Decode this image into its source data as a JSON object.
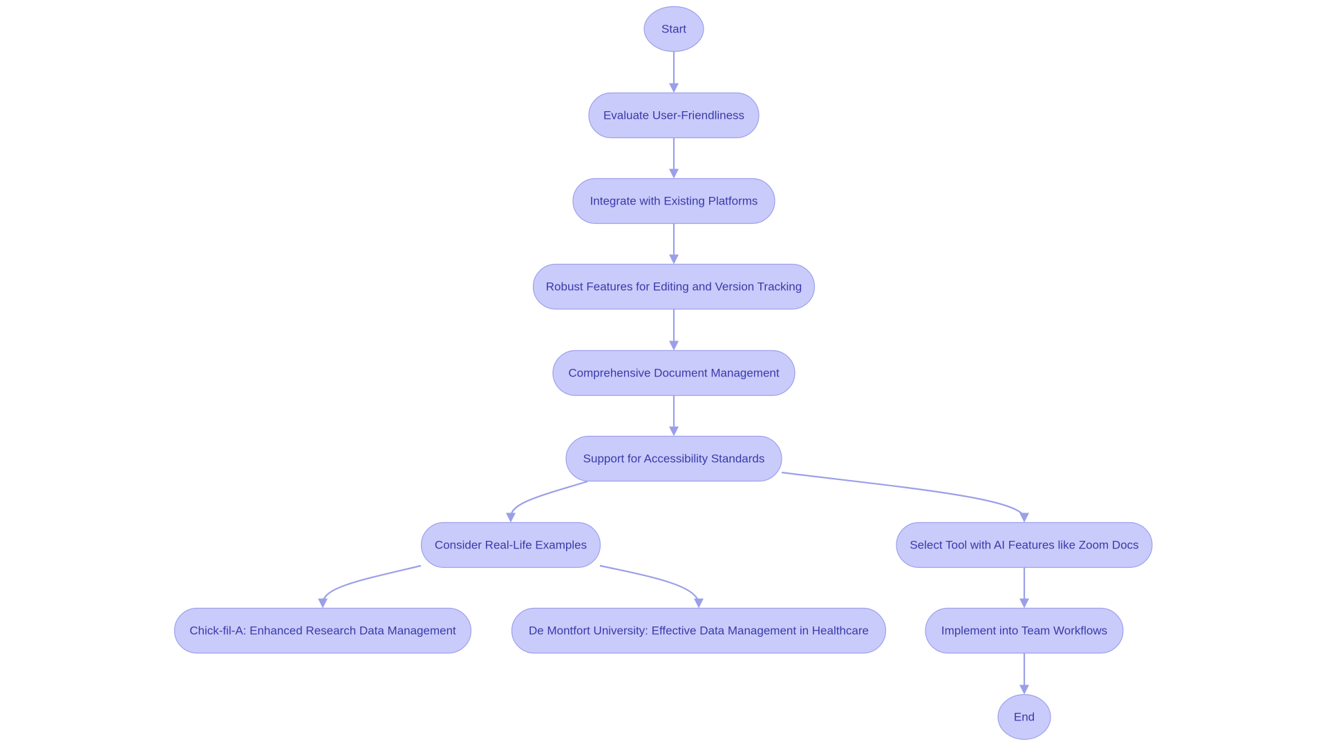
{
  "diagram": {
    "type": "flowchart",
    "direction": "top-down",
    "colors": {
      "node_fill": "#c9cbfb",
      "node_border": "#9ea1ea",
      "node_text": "#3a3aa8",
      "edge": "#9a9fe8",
      "background": "#ffffff"
    },
    "nodes": [
      {
        "id": "start",
        "label": "Start",
        "shape": "circle"
      },
      {
        "id": "evaluate",
        "label": "Evaluate User-Friendliness",
        "shape": "stadium"
      },
      {
        "id": "integrate",
        "label": "Integrate with Existing Platforms",
        "shape": "stadium"
      },
      {
        "id": "robust",
        "label": "Robust Features for Editing and Version Tracking",
        "shape": "stadium"
      },
      {
        "id": "comprehensive",
        "label": "Comprehensive Document Management",
        "shape": "stadium"
      },
      {
        "id": "support",
        "label": "Support for Accessibility Standards",
        "shape": "stadium"
      },
      {
        "id": "consider",
        "label": "Consider Real-Life Examples",
        "shape": "stadium"
      },
      {
        "id": "select",
        "label": "Select Tool with AI Features like Zoom Docs",
        "shape": "stadium"
      },
      {
        "id": "chickfila",
        "label": "Chick-fil-A: Enhanced Research Data Management",
        "shape": "stadium"
      },
      {
        "id": "demontfort",
        "label": "De Montfort University: Effective Data Management in Healthcare",
        "shape": "stadium"
      },
      {
        "id": "implement",
        "label": "Implement into Team Workflows",
        "shape": "stadium"
      },
      {
        "id": "end",
        "label": "End",
        "shape": "circle"
      }
    ],
    "edges": [
      {
        "from": "start",
        "to": "evaluate"
      },
      {
        "from": "evaluate",
        "to": "integrate"
      },
      {
        "from": "integrate",
        "to": "robust"
      },
      {
        "from": "robust",
        "to": "comprehensive"
      },
      {
        "from": "comprehensive",
        "to": "support"
      },
      {
        "from": "support",
        "to": "consider"
      },
      {
        "from": "support",
        "to": "select"
      },
      {
        "from": "consider",
        "to": "chickfila"
      },
      {
        "from": "consider",
        "to": "demontfort"
      },
      {
        "from": "select",
        "to": "implement"
      },
      {
        "from": "implement",
        "to": "end"
      }
    ]
  }
}
